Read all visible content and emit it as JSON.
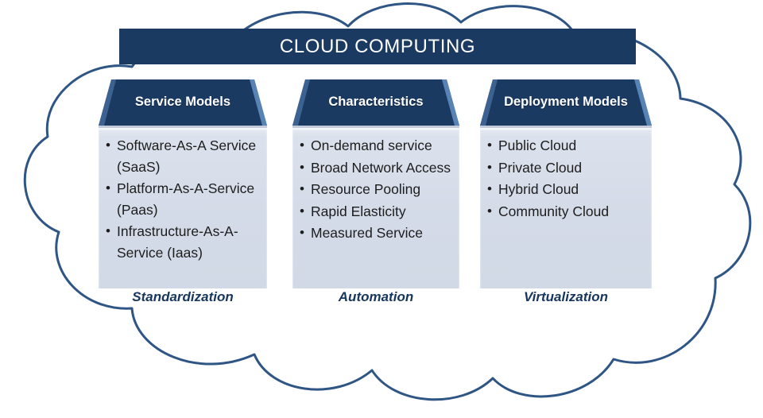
{
  "banner": {
    "title": "CLOUD COMPUTING"
  },
  "colors": {
    "navy": "#1b3a61",
    "cloud_stroke": "#2e5584",
    "panel": "#d4dbe8",
    "caption": "#17365d",
    "header_text": "#ffffff"
  },
  "columns": [
    {
      "key": "service",
      "header": "Service Models",
      "items": [
        "Software-As-A Service (SaaS)",
        "Platform-As-A-Service (Paas)",
        "Infrastructure-As-A-Service (Iaas)"
      ],
      "caption": "Standardization"
    },
    {
      "key": "characteristics",
      "header": "Characteristics",
      "items": [
        "On-demand service",
        "Broad Network Access",
        "Resource Pooling",
        "Rapid Elasticity",
        "Measured Service"
      ],
      "caption": "Automation"
    },
    {
      "key": "deployment",
      "header": "Deployment Models",
      "items": [
        "Public Cloud",
        "Private Cloud",
        "Hybrid Cloud",
        "Community Cloud"
      ],
      "caption": "Virtualization"
    }
  ],
  "shapes": {
    "cloud_icon": "cloud-outline"
  }
}
